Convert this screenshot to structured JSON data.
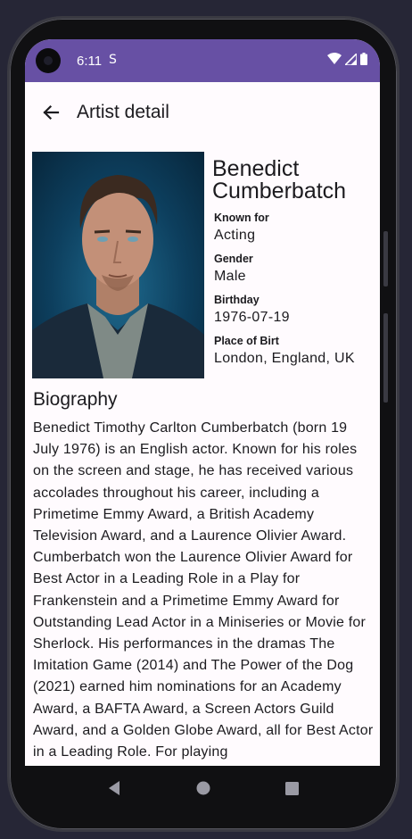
{
  "status_bar": {
    "time": "6:11",
    "sim_glyph": "S",
    "icons": [
      "wifi-icon",
      "signal-icon",
      "battery-icon"
    ]
  },
  "app_bar": {
    "title": "Artist detail",
    "back_icon": "arrow-back-icon"
  },
  "artist": {
    "name_line1": "Benedict",
    "name_line2": "Cumberbatch",
    "fields": [
      {
        "label": "Known for",
        "value": "Acting"
      },
      {
        "label": "Gender",
        "value": "Male"
      },
      {
        "label": "Birthday",
        "value": "1976-07-19"
      },
      {
        "label": "Place of Birt",
        "value": "London, England, UK"
      }
    ]
  },
  "biography": {
    "title": "Biography",
    "text": "Benedict Timothy Carlton Cumberbatch (born 19 July 1976) is an English actor. Known for his roles on the screen and stage, he has received various accolades throughout his career, including a Primetime Emmy Award, a British Academy Television Award, and a Laurence Olivier Award. Cumberbatch won the Laurence Olivier Award for Best Actor in a Leading Role in a Play for Frankenstein and a Primetime Emmy Award for Outstanding Lead Actor in a Miniseries or Movie for Sherlock. His performances in the dramas The Imitation Game (2014) and The Power of the Dog (2021) earned him nominations for an Academy Award, a BAFTA Award, a Screen Actors Guild Award, and a Golden Globe Award, all for Best Actor in a Leading Role. For playing"
  },
  "nav": {
    "icons": [
      "back-triangle-icon",
      "home-circle-icon",
      "recents-square-icon"
    ]
  },
  "colors": {
    "status_bar": "#6750a4",
    "background": "#fffbfe",
    "text": "#1c1b1f"
  }
}
